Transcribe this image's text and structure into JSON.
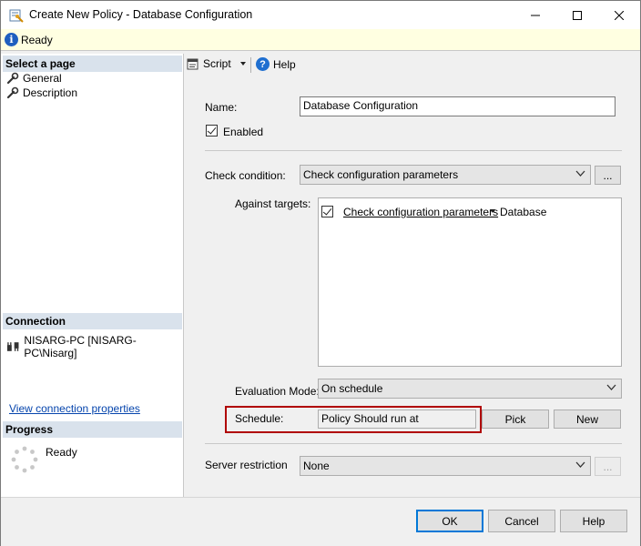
{
  "window": {
    "title": "Create New Policy - Database Configuration"
  },
  "status": {
    "text": "Ready"
  },
  "left": {
    "select_page_header": "Select a page",
    "pages": [
      "General",
      "Description"
    ],
    "connection_header": "Connection",
    "connection_name": "NISARG-PC [NISARG-PC\\Nisarg]",
    "view_connection_link": "View connection properties",
    "progress_header": "Progress",
    "progress_status": "Ready"
  },
  "toolbar": {
    "script_label": "Script",
    "help_label": "Help"
  },
  "form": {
    "name_label": "Name:",
    "name_value": "Database Configuration",
    "enabled_label": "Enabled",
    "check_condition_label": "Check condition:",
    "check_condition_value": "Check configuration parameters",
    "ellipsis_label": "...",
    "against_targets_label": "Against targets:",
    "target_condition": "Check configuration parameters",
    "target_object": "Database",
    "evaluation_mode_label": "Evaluation Mode:",
    "evaluation_mode_value": "On schedule",
    "schedule_label": "Schedule:",
    "schedule_value": "Policy Should run at",
    "pick_label": "Pick",
    "new_label": "New",
    "server_restriction_label": "Server restriction",
    "server_restriction_value": "None",
    "server_ellipsis_label": "..."
  },
  "footer": {
    "ok_label": "OK",
    "cancel_label": "Cancel",
    "help_label": "Help"
  },
  "colors": {
    "accent": "#0078d7",
    "highlight_border": "#b00000",
    "status_bar": "#ffffe1",
    "header_bg": "#d9e2ec"
  }
}
